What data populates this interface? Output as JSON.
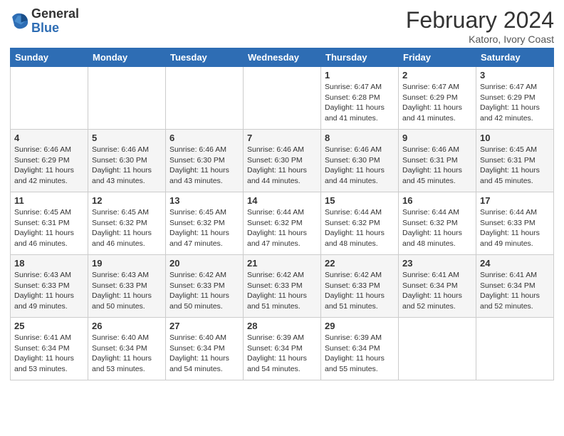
{
  "header": {
    "logo": {
      "general": "General",
      "blue": "Blue",
      "icon_title": "General Blue Logo"
    },
    "title": "February 2024",
    "subtitle": "Katoro, Ivory Coast"
  },
  "days_of_week": [
    "Sunday",
    "Monday",
    "Tuesday",
    "Wednesday",
    "Thursday",
    "Friday",
    "Saturday"
  ],
  "weeks": [
    [
      {
        "day": "",
        "info": ""
      },
      {
        "day": "",
        "info": ""
      },
      {
        "day": "",
        "info": ""
      },
      {
        "day": "",
        "info": ""
      },
      {
        "day": "1",
        "info": "Sunrise: 6:47 AM\nSunset: 6:28 PM\nDaylight: 11 hours and 41 minutes."
      },
      {
        "day": "2",
        "info": "Sunrise: 6:47 AM\nSunset: 6:29 PM\nDaylight: 11 hours and 41 minutes."
      },
      {
        "day": "3",
        "info": "Sunrise: 6:47 AM\nSunset: 6:29 PM\nDaylight: 11 hours and 42 minutes."
      }
    ],
    [
      {
        "day": "4",
        "info": "Sunrise: 6:46 AM\nSunset: 6:29 PM\nDaylight: 11 hours and 42 minutes."
      },
      {
        "day": "5",
        "info": "Sunrise: 6:46 AM\nSunset: 6:30 PM\nDaylight: 11 hours and 43 minutes."
      },
      {
        "day": "6",
        "info": "Sunrise: 6:46 AM\nSunset: 6:30 PM\nDaylight: 11 hours and 43 minutes."
      },
      {
        "day": "7",
        "info": "Sunrise: 6:46 AM\nSunset: 6:30 PM\nDaylight: 11 hours and 44 minutes."
      },
      {
        "day": "8",
        "info": "Sunrise: 6:46 AM\nSunset: 6:30 PM\nDaylight: 11 hours and 44 minutes."
      },
      {
        "day": "9",
        "info": "Sunrise: 6:46 AM\nSunset: 6:31 PM\nDaylight: 11 hours and 45 minutes."
      },
      {
        "day": "10",
        "info": "Sunrise: 6:45 AM\nSunset: 6:31 PM\nDaylight: 11 hours and 45 minutes."
      }
    ],
    [
      {
        "day": "11",
        "info": "Sunrise: 6:45 AM\nSunset: 6:31 PM\nDaylight: 11 hours and 46 minutes."
      },
      {
        "day": "12",
        "info": "Sunrise: 6:45 AM\nSunset: 6:32 PM\nDaylight: 11 hours and 46 minutes."
      },
      {
        "day": "13",
        "info": "Sunrise: 6:45 AM\nSunset: 6:32 PM\nDaylight: 11 hours and 47 minutes."
      },
      {
        "day": "14",
        "info": "Sunrise: 6:44 AM\nSunset: 6:32 PM\nDaylight: 11 hours and 47 minutes."
      },
      {
        "day": "15",
        "info": "Sunrise: 6:44 AM\nSunset: 6:32 PM\nDaylight: 11 hours and 48 minutes."
      },
      {
        "day": "16",
        "info": "Sunrise: 6:44 AM\nSunset: 6:32 PM\nDaylight: 11 hours and 48 minutes."
      },
      {
        "day": "17",
        "info": "Sunrise: 6:44 AM\nSunset: 6:33 PM\nDaylight: 11 hours and 49 minutes."
      }
    ],
    [
      {
        "day": "18",
        "info": "Sunrise: 6:43 AM\nSunset: 6:33 PM\nDaylight: 11 hours and 49 minutes."
      },
      {
        "day": "19",
        "info": "Sunrise: 6:43 AM\nSunset: 6:33 PM\nDaylight: 11 hours and 50 minutes."
      },
      {
        "day": "20",
        "info": "Sunrise: 6:42 AM\nSunset: 6:33 PM\nDaylight: 11 hours and 50 minutes."
      },
      {
        "day": "21",
        "info": "Sunrise: 6:42 AM\nSunset: 6:33 PM\nDaylight: 11 hours and 51 minutes."
      },
      {
        "day": "22",
        "info": "Sunrise: 6:42 AM\nSunset: 6:33 PM\nDaylight: 11 hours and 51 minutes."
      },
      {
        "day": "23",
        "info": "Sunrise: 6:41 AM\nSunset: 6:34 PM\nDaylight: 11 hours and 52 minutes."
      },
      {
        "day": "24",
        "info": "Sunrise: 6:41 AM\nSunset: 6:34 PM\nDaylight: 11 hours and 52 minutes."
      }
    ],
    [
      {
        "day": "25",
        "info": "Sunrise: 6:41 AM\nSunset: 6:34 PM\nDaylight: 11 hours and 53 minutes."
      },
      {
        "day": "26",
        "info": "Sunrise: 6:40 AM\nSunset: 6:34 PM\nDaylight: 11 hours and 53 minutes."
      },
      {
        "day": "27",
        "info": "Sunrise: 6:40 AM\nSunset: 6:34 PM\nDaylight: 11 hours and 54 minutes."
      },
      {
        "day": "28",
        "info": "Sunrise: 6:39 AM\nSunset: 6:34 PM\nDaylight: 11 hours and 54 minutes."
      },
      {
        "day": "29",
        "info": "Sunrise: 6:39 AM\nSunset: 6:34 PM\nDaylight: 11 hours and 55 minutes."
      },
      {
        "day": "",
        "info": ""
      },
      {
        "day": "",
        "info": ""
      }
    ]
  ]
}
